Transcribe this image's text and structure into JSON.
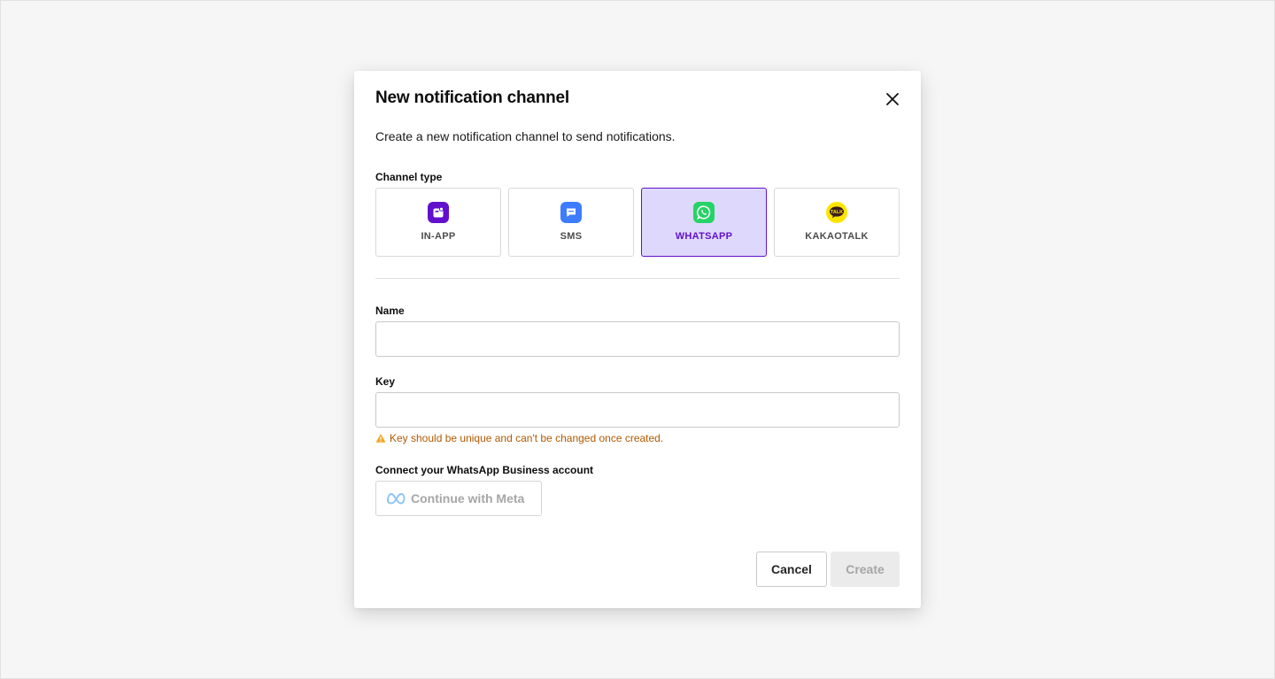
{
  "dialog": {
    "title": "New notification channel",
    "description": "Create a new notification channel to send notifications."
  },
  "channel_type": {
    "label": "Channel type",
    "selected": "WHATSAPP",
    "options": [
      {
        "label": "IN-APP",
        "icon": "in-app-icon",
        "color": "#6210cc"
      },
      {
        "label": "SMS",
        "icon": "chat-bubble-icon",
        "color": "#3d7bff"
      },
      {
        "label": "WHATSAPP",
        "icon": "whatsapp-icon",
        "color": "#25d366"
      },
      {
        "label": "KAKAOTALK",
        "icon": "kakaotalk-icon",
        "color": "#fee500"
      }
    ]
  },
  "form": {
    "name": {
      "label": "Name",
      "value": ""
    },
    "key": {
      "label": "Key",
      "value": "",
      "hint": "Key should be unique and can't be changed once created."
    },
    "connect": {
      "label": "Connect your WhatsApp Business account",
      "button_label": "Continue with Meta"
    }
  },
  "footer": {
    "cancel_label": "Cancel",
    "create_label": "Create"
  },
  "colors": {
    "accent": "#6210cc",
    "selected_bg": "#ded9fc",
    "warning": "#b35a00"
  }
}
